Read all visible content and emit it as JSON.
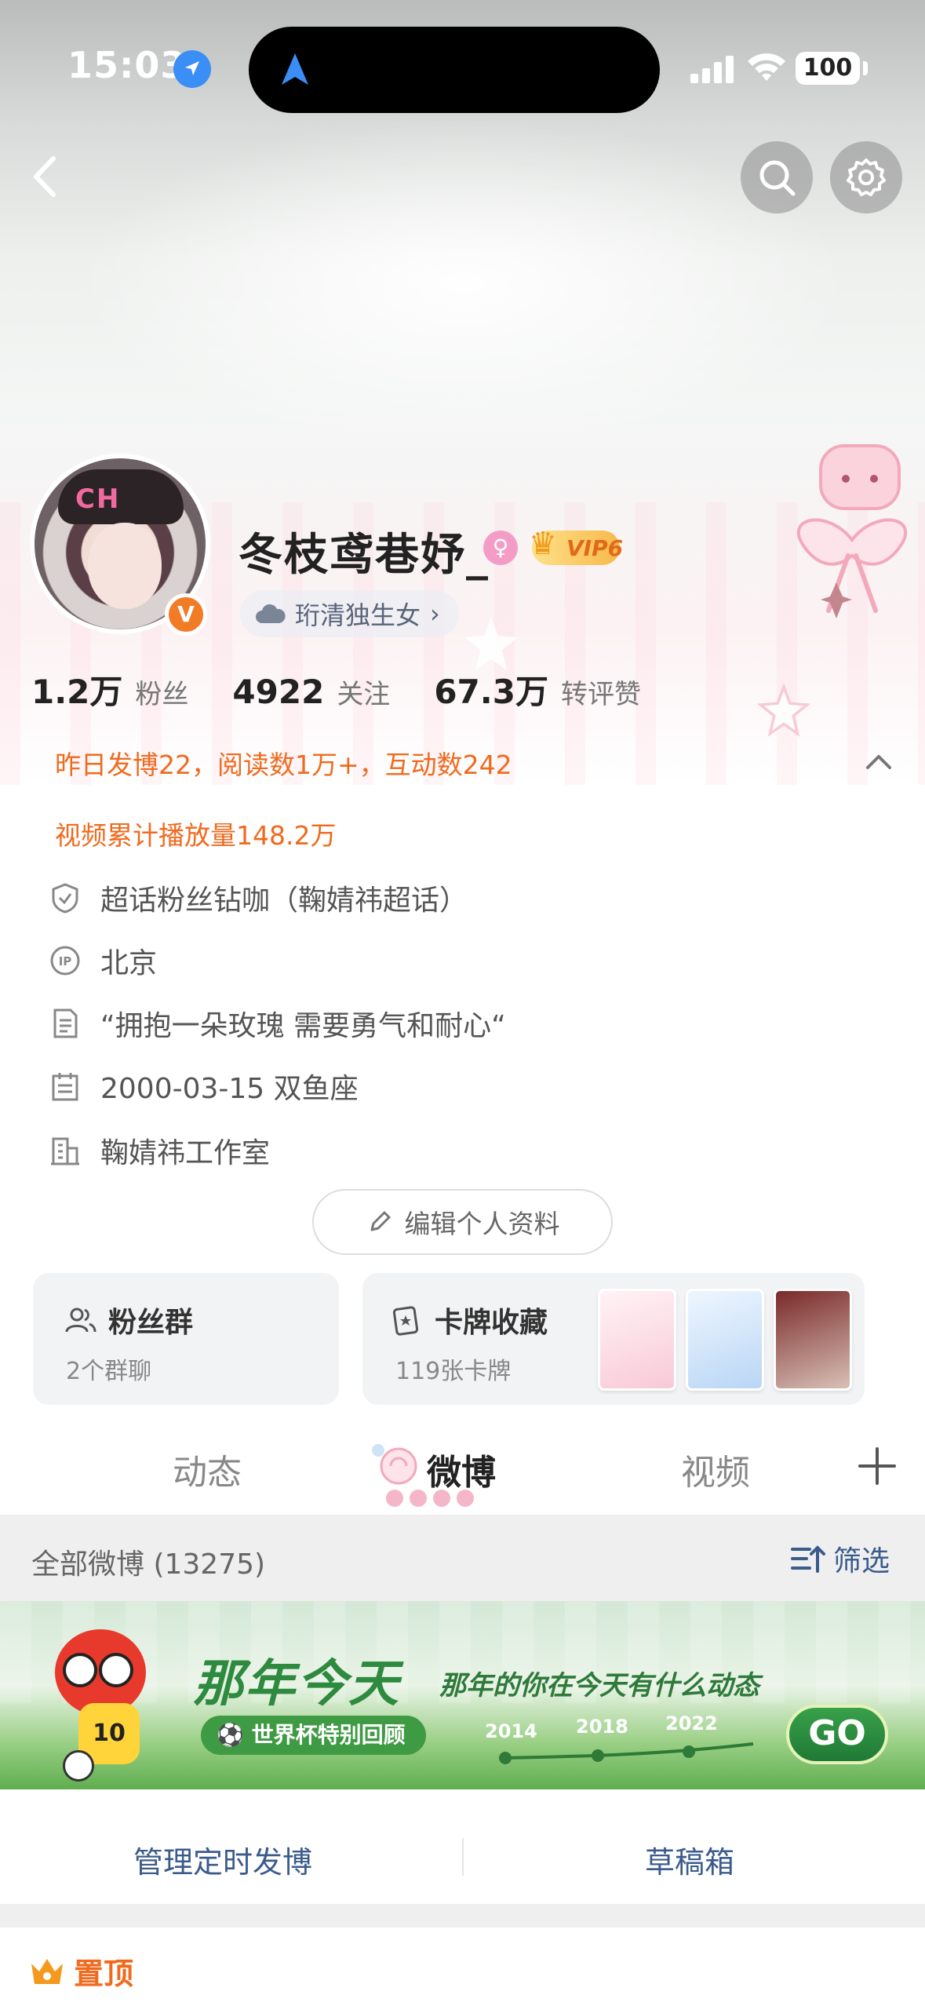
{
  "status_bar": {
    "time": "15:03",
    "battery": "100"
  },
  "nav": {
    "back_icon": "chevron-left-icon",
    "search_icon": "search-icon",
    "settings_icon": "gear-icon"
  },
  "profile": {
    "avatar_hat_text": "CH",
    "verify_badge": "V",
    "username": "冬枝鸢巷妤_",
    "vip_label": "VIP6",
    "tag": "珩清独生女",
    "tag_arrow": "›",
    "stats": [
      {
        "value": "1.2万",
        "label": "粉丝"
      },
      {
        "value": "4922",
        "label": "关注"
      },
      {
        "value": "67.3万",
        "label": "转评赞"
      }
    ]
  },
  "info": {
    "yesterday": "昨日发博22，阅读数1万+，互动数242",
    "video_plays": "视频累计播放量148.2万",
    "rows": [
      {
        "icon": "shield-icon",
        "text": "超话粉丝钻咖（鞠婧祎超话）"
      },
      {
        "icon": "ip-icon",
        "text": "北京"
      },
      {
        "icon": "document-icon",
        "text": "“拥抱一朵玫瑰 需要勇气和耐心“"
      },
      {
        "icon": "calendar-icon",
        "text": "2000-03-15 双鱼座"
      },
      {
        "icon": "building-icon",
        "text": "鞠婧祎工作室"
      }
    ],
    "edit_label": "编辑个人资料"
  },
  "cards": {
    "fans_group": {
      "title": "粉丝群",
      "sub": "2个群聊"
    },
    "card_collection": {
      "title": "卡牌收藏",
      "sub": "119张卡牌"
    }
  },
  "tabs": {
    "items": [
      "动态",
      "微博",
      "视频"
    ],
    "active": "微博"
  },
  "filter": {
    "count_label": "全部微博 (13275)",
    "filter_label": "筛选"
  },
  "banner": {
    "title": "那年今天",
    "subtitle": "那年的你在今天有什么动态",
    "pill": "⚽ 世界杯特别回顾",
    "years": [
      "2014",
      "2018",
      "2022"
    ],
    "go": "GO",
    "mascot_number": "10"
  },
  "manage": {
    "scheduled": "管理定时发博",
    "drafts": "草稿箱"
  },
  "pinned": {
    "label": "置顶"
  },
  "colors": {
    "accent_orange": "#f06a1e",
    "link_blue": "#3b5b8c",
    "banner_green": "#2e8a3e"
  }
}
